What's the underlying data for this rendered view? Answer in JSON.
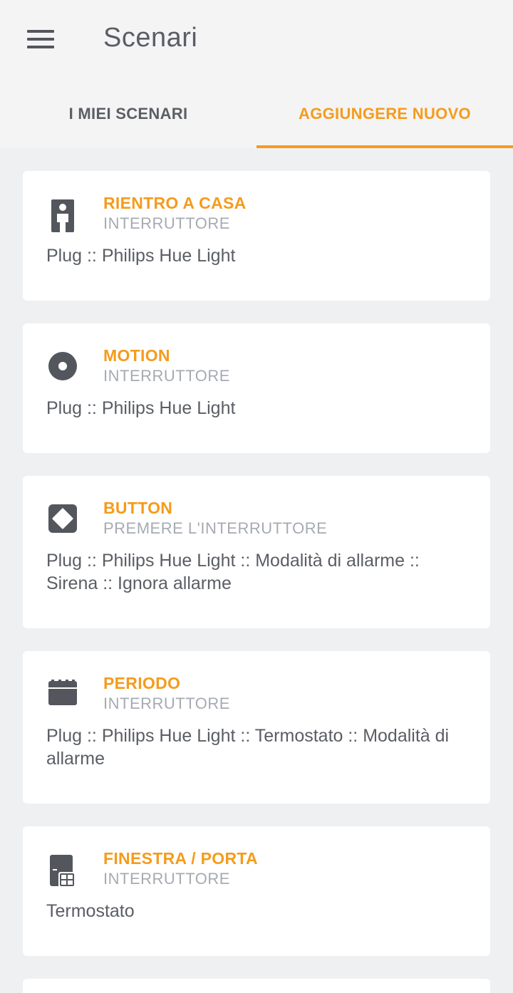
{
  "header": {
    "title": "Scenari",
    "menu_icon": "hamburger-menu-icon"
  },
  "tabs": [
    {
      "label": "I MIEI SCENARI",
      "active": false
    },
    {
      "label": "AGGIUNGERE NUOVO",
      "active": true
    }
  ],
  "colors": {
    "accent": "#f59b1c",
    "background": "#eff0f2",
    "card": "#ffffff",
    "icon": "#53575d"
  },
  "scenarios": [
    {
      "name": "RIENTRO A CASA",
      "type": "INTERRUTTORE",
      "devices": "Plug :: Philips Hue Light",
      "icon": "person-icon"
    },
    {
      "name": "MOTION",
      "type": "INTERRUTTORE",
      "devices": "Plug :: Philips Hue Light",
      "icon": "motion-sensor-icon"
    },
    {
      "name": "BUTTON",
      "type": "PREMERE L'INTERRUTTORE",
      "devices": "Plug :: Philips Hue Light :: Modalità di allarme :: Sirena :: Ignora allarme",
      "icon": "button-icon"
    },
    {
      "name": "PERIODO",
      "type": "INTERRUTTORE",
      "devices": "Plug :: Philips Hue Light :: Termostato :: Modalità di allarme",
      "icon": "calendar-icon"
    },
    {
      "name": "FINESTRA / PORTA",
      "type": "INTERRUTTORE",
      "devices": "Termostato",
      "icon": "window-door-icon"
    }
  ]
}
